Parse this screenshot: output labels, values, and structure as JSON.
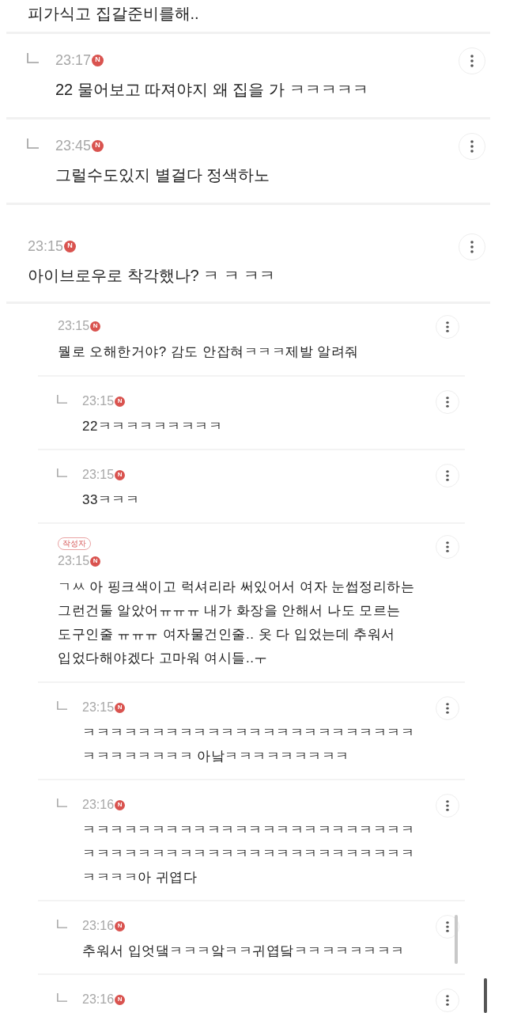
{
  "comments": [
    {
      "kind": "comment",
      "text": "피가식고 집갈준비를해..",
      "children": [
        {
          "kind": "reply",
          "time": "23:17",
          "new_label": "N",
          "text": "22 물어보고 따져야지 왜 집을 가 ㅋㅋㅋㅋㅋ"
        },
        {
          "kind": "reply",
          "time": "23:45",
          "new_label": "N",
          "text": "그럴수도있지 별걸다 정색하노"
        }
      ]
    },
    {
      "kind": "comment",
      "time": "23:15",
      "new_label": "N",
      "text": "아이브로우로 착각했나? ㅋ ㅋ ㅋㅋ",
      "children": [
        {
          "kind": "comment",
          "time": "23:15",
          "new_label": "N",
          "text": "뭘로 오해한거야? 감도 안잡혀ㅋㅋㅋ제발 알려줘",
          "children": [
            {
              "kind": "reply",
              "time": "23:15",
              "new_label": "N",
              "text": "22ㅋㅋㅋㅋㅋㅋㅋㅋㅋ"
            },
            {
              "kind": "reply",
              "time": "23:15",
              "new_label": "N",
              "text": "33ㅋㅋㅋ"
            }
          ]
        },
        {
          "kind": "comment",
          "author_badge": "작성자",
          "time": "23:15",
          "new_label": "N",
          "text": "ㄱㅆ 아 핑크색이고 럭셔리라 써있어서 여자 눈썹정리하는 그런건둘 알았어ㅠㅠㅠ 내가 화장을 안해서 나도 모르는 도구인줄 ㅠㅠㅠ 여자물건인줄.. 옷 다 입었는데 추워서 입었다해야겠다 고마워 여시들..ㅜ",
          "children": [
            {
              "kind": "reply",
              "time": "23:15",
              "new_label": "N",
              "text": "ㅋㅋㅋㅋㅋㅋㅋㅋㅋㅋㅋㅋㅋㅋㅋㅋㅋㅋㅋㅋㅋㅋㅋㅋㅋㅋㅋㅋㅋㅋㅋㅋ 아낰ㅋㅋㅋㅋㅋㅋㅋㅋㅋ"
            },
            {
              "kind": "reply",
              "time": "23:16",
              "new_label": "N",
              "text": "ㅋㅋㅋㅋㅋㅋㅋㅋㅋㅋㅋㅋㅋㅋㅋㅋㅋㅋㅋㅋㅋㅋㅋㅋㅋㅋㅋㅋㅋㅋㅋㅋㅋㅋㅋㅋㅋㅋㅋㅋㅋㅋㅋㅋㅋㅋㅋㅋㅋㅋㅋㅋ아 귀엽다"
            },
            {
              "kind": "reply",
              "time": "23:16",
              "new_label": "N",
              "text": "추워서 입엇댘ㅋㅋㅋ앜ㅋㅋ귀엽닼ㅋㅋㅋㅋㅋㅋㅋㅋ"
            },
            {
              "kind": "reply",
              "time": "23:16",
              "new_label": "N"
            }
          ]
        }
      ]
    }
  ]
}
